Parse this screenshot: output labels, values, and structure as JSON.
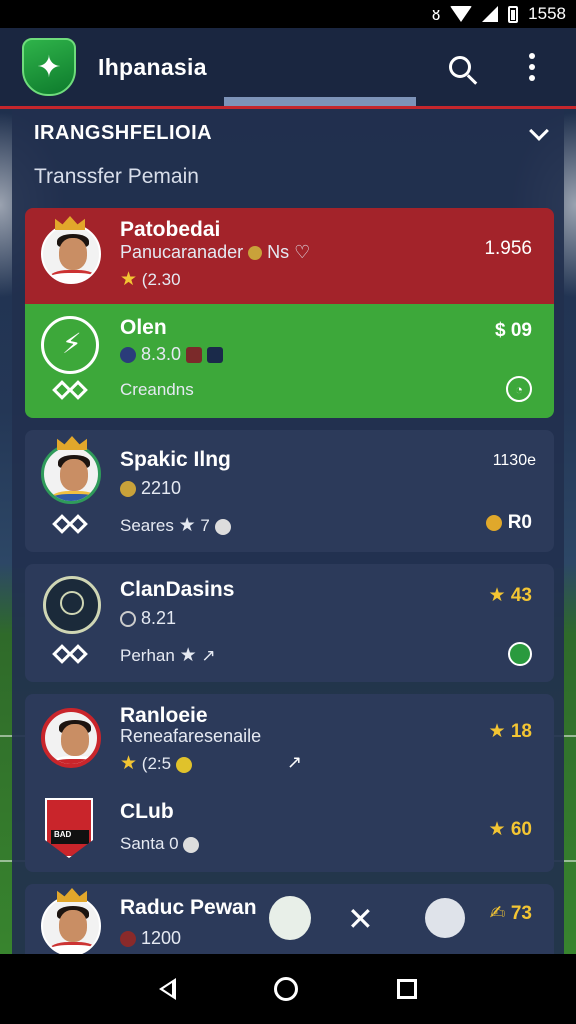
{
  "statusbar": {
    "time": "1558"
  },
  "appbar": {
    "title": "Ihpanasia",
    "logo_icon": "shield-logo-icon"
  },
  "section": {
    "title": "IRANGSHFELIOIA",
    "subtitle": "Transsfer Pemain"
  },
  "cards": [
    {
      "name": "Patobedai",
      "line2": "Panucaranader",
      "line2_extra": "Ns ♡",
      "rating": "(2.30",
      "value": "1.956",
      "color": "#a3232a"
    },
    {
      "name": "Olen",
      "line2": "8.3.0",
      "line3": "Creandns",
      "value": "09",
      "color": "#3da83a"
    },
    {
      "name": "Spakic Ilng",
      "line2": "2210",
      "line3": "Seares",
      "line3_extra": "7",
      "value": "1130e",
      "value2": "R0"
    },
    {
      "name": "ClanDasins",
      "line2": "8.21",
      "line3": "Perhan",
      "value": "43"
    },
    {
      "name": "Ranloeie",
      "line2": "Reneafaresenaile",
      "rating": "(2:5",
      "value": "18",
      "club_name": "CLub",
      "club_line": "Santa 0",
      "club_value": "60",
      "club_crest_text": "BAD"
    },
    {
      "name": "Raduc Pewan",
      "line2": "1200",
      "value": "73"
    }
  ],
  "colors": {
    "accent_red": "#c5262c",
    "gold": "#f3c533",
    "panel": "#22304e",
    "card": "#2c3a5a"
  }
}
